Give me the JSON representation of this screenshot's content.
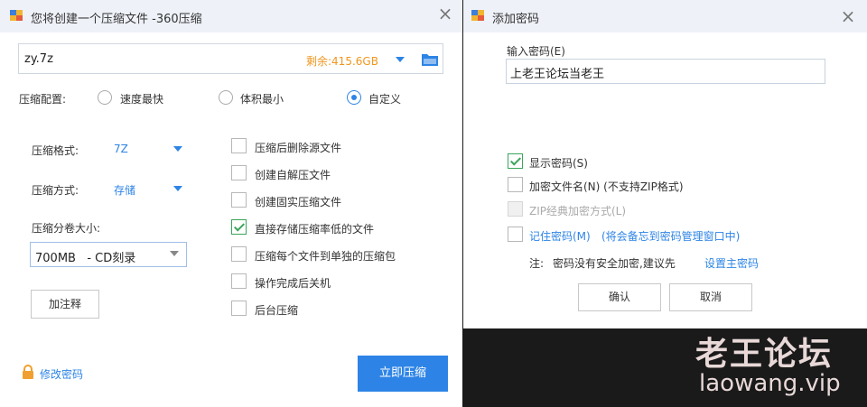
{
  "left": {
    "title": "您将创建一个压缩文件 -360压缩",
    "path_value": "zy.7z",
    "remaining": "剩余:415.6GB",
    "config_label": "压缩配置:",
    "radios": [
      {
        "label": "速度最快",
        "checked": false
      },
      {
        "label": "体积最小",
        "checked": false
      },
      {
        "label": "自定义",
        "checked": true
      }
    ],
    "format_label": "压缩格式:",
    "format_value": "7Z",
    "method_label": "压缩方式:",
    "method_value": "存储",
    "split_label": "压缩分卷大小:",
    "split_value": "700MB   - CD刻录",
    "add_comment": "加注释",
    "options": [
      {
        "label": "压缩后删除源文件",
        "checked": false
      },
      {
        "label": "创建自解压文件",
        "checked": false
      },
      {
        "label": "创建固实压缩文件",
        "checked": false
      },
      {
        "label": "直接存储压缩率低的文件",
        "checked": true
      },
      {
        "label": "压缩每个文件到单独的压缩包",
        "checked": false
      },
      {
        "label": "操作完成后关机",
        "checked": false
      },
      {
        "label": "后台压缩",
        "checked": false
      }
    ],
    "change_password": "修改密码",
    "compress_now": "立即压缩"
  },
  "right": {
    "title": "添加密码",
    "input_label": "输入密码(E)",
    "password_value": "上老王论坛当老王",
    "options": [
      {
        "label": "显示密码(S)",
        "checked": true,
        "disabled": false
      },
      {
        "label": "加密文件名(N) (不支持ZIP格式)",
        "checked": false,
        "disabled": false
      },
      {
        "label": "ZIP经典加密方式(L)",
        "checked": false,
        "disabled": true
      }
    ],
    "remember_label": "记住密码(M)",
    "remember_note": "(将会备忘到密码管理窗口中)",
    "note_prefix": "注:",
    "note_text": "密码没有安全加密,建议先",
    "note_link": "设置主密码",
    "ok": "确认",
    "cancel": "取消"
  },
  "watermark": {
    "title": "老王论坛",
    "url": "laowang.vip"
  },
  "colors": {
    "accent": "#2d84e6",
    "remaining": "#f0961e",
    "check_green": "#3aa55a",
    "primary_button": "#2d84e6"
  }
}
